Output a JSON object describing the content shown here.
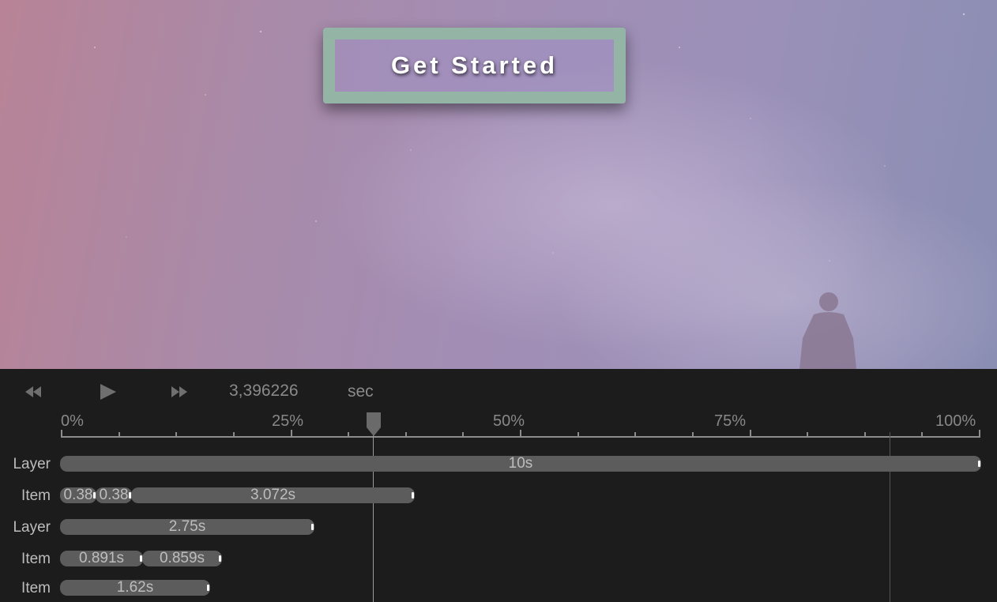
{
  "stage": {
    "cta_label": "Get Started",
    "colors": {
      "cta_border": "#94b5a6",
      "sky_left": "#b88396",
      "sky_right": "#8a8eb3"
    }
  },
  "transport": {
    "rewind_icon": "rewind-icon",
    "play_icon": "play-icon",
    "fast_forward_icon": "fast-forward-icon",
    "time_value": "3,396226",
    "time_unit": "sec"
  },
  "ruler": {
    "labels": [
      "0%",
      "25%",
      "50%",
      "75%",
      "100%"
    ]
  },
  "playhead": {
    "position_fraction": 0.34
  },
  "tracks": [
    {
      "label": "Layer",
      "bars": [
        {
          "text": "10s"
        }
      ]
    },
    {
      "label": "Item",
      "bars": [
        {
          "text": "0.38"
        },
        {
          "text": "0.38"
        },
        {
          "text": "3.072s"
        }
      ]
    },
    {
      "label": "Layer",
      "bars": [
        {
          "text": "2.75s"
        }
      ]
    },
    {
      "label": "Item",
      "bars": [
        {
          "text": "0.891s"
        },
        {
          "text": "0.859s"
        }
      ]
    },
    {
      "label": "Item",
      "bars": [
        {
          "text": "1.62s"
        }
      ]
    }
  ],
  "colors": {
    "panel_bg": "#1c1c1c",
    "bar_bg": "#5c5c5c",
    "text": "#bdbdbd"
  }
}
